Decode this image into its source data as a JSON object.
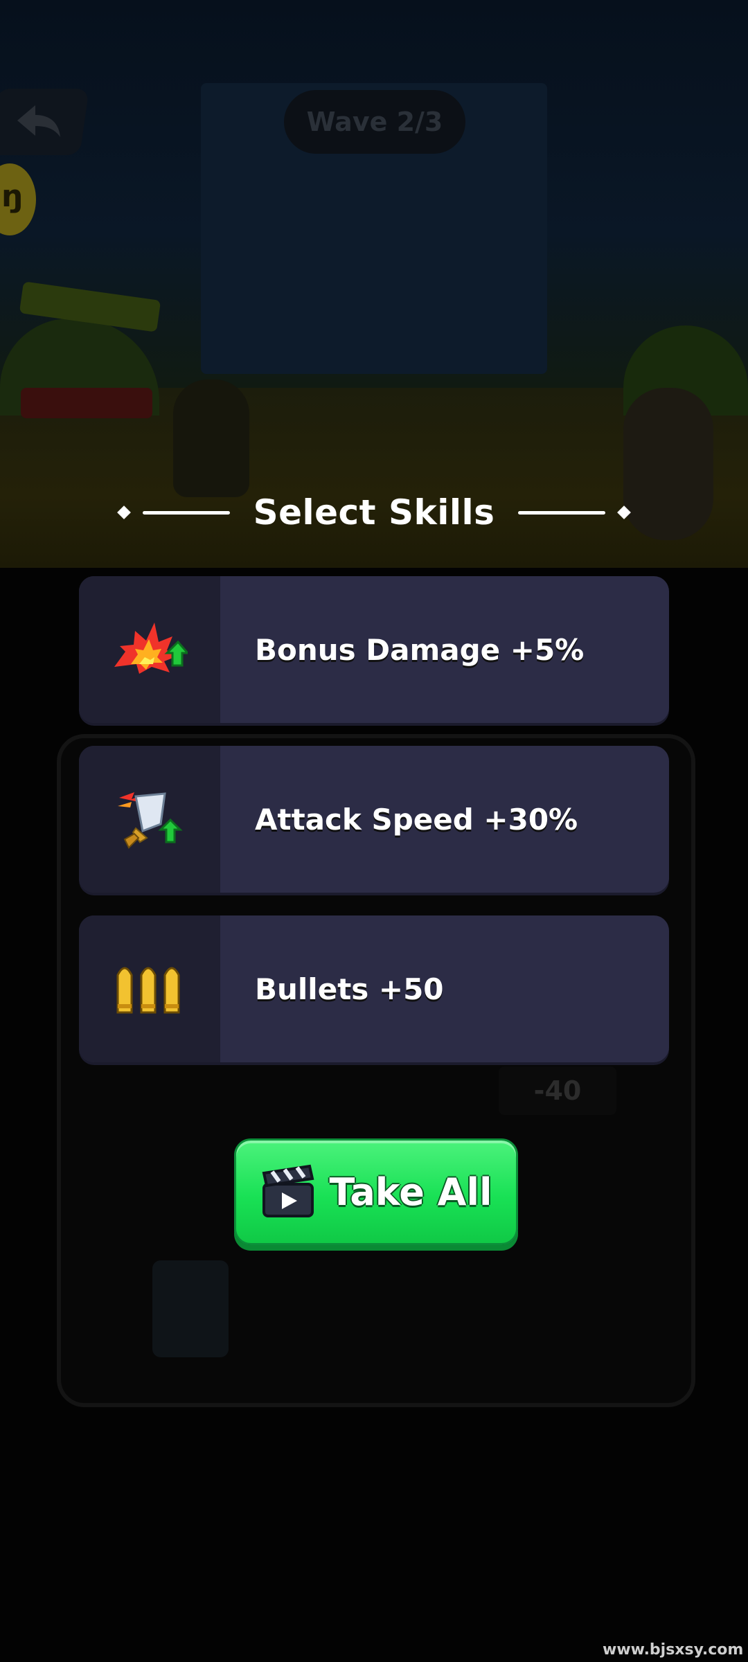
{
  "hud": {
    "wave_label": "Wave 2/3",
    "back_icon": "back-arrow-icon",
    "coin_glyph": "ŋ",
    "background_value": "-40"
  },
  "skills_panel": {
    "title": "Select Skills",
    "skills": [
      {
        "label": "Bonus Damage +5%",
        "icon": "explosion-up-icon"
      },
      {
        "label": "Attack Speed +30%",
        "icon": "sword-speed-up-icon"
      },
      {
        "label": "Bullets +50",
        "icon": "bullets-icon"
      }
    ],
    "take_all_label": "Take All",
    "take_all_icon": "video-clapperboard-icon"
  },
  "watermark": "www.bjsxsy.com",
  "colors": {
    "card_bg": "#2c2c46",
    "card_icon_bg": "#1f1f31",
    "button_green": "#19e155"
  }
}
